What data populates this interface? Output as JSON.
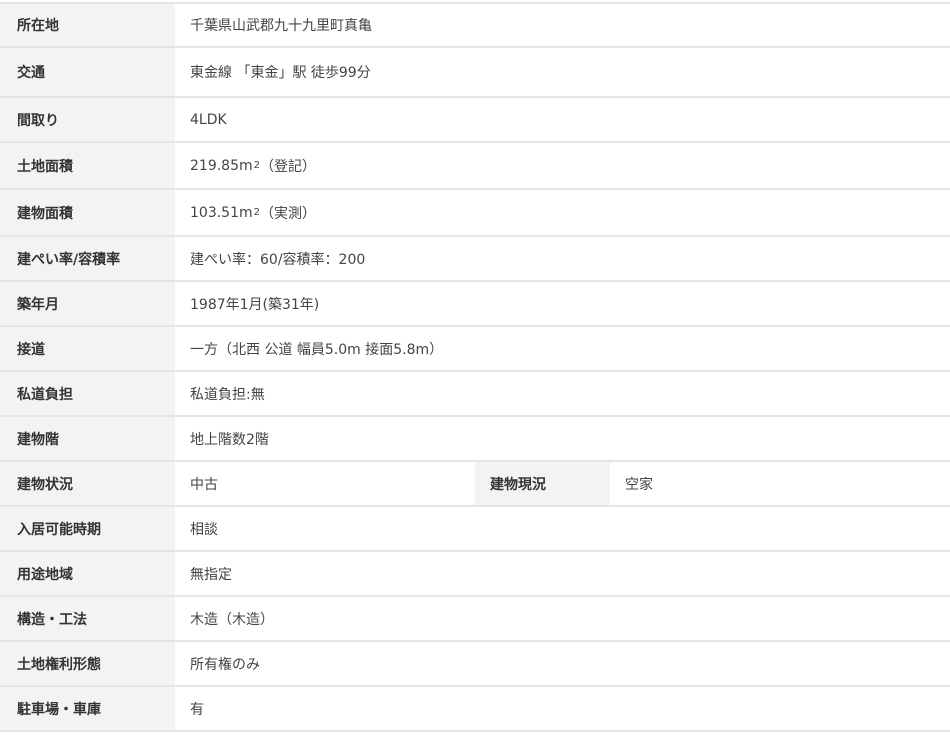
{
  "rows": [
    {
      "label": "所在地",
      "value": "千葉県山武郡九十九里町真亀"
    },
    {
      "label": "交通",
      "value": "東金線 「東金」駅 徒歩99分"
    },
    {
      "label": "間取り",
      "value": "4LDK"
    },
    {
      "label": "土地面積",
      "value_pre": "219.85m",
      "value_sup": "2",
      "value_post": "（登記）"
    },
    {
      "label": "建物面積",
      "value_pre": "103.51m",
      "value_sup": "2",
      "value_post": "（実測）"
    },
    {
      "label": "建ぺい率/容積率",
      "value": "建ぺい率：60/容積率：200"
    },
    {
      "label": "築年月",
      "value": "1987年1月(築31年)"
    },
    {
      "label": "接道",
      "value": "一方（北西 公道 幅員5.0m 接面5.8m）"
    },
    {
      "label": "私道負担",
      "value": "私道負担:無"
    },
    {
      "label": "建物階",
      "value": "地上階数2階"
    },
    {
      "label": "建物状況",
      "value": "中古",
      "label2": "建物現況",
      "value2": "空家"
    },
    {
      "label": "入居可能時期",
      "value": "相談"
    },
    {
      "label": "用途地域",
      "value": "無指定"
    },
    {
      "label": "構造・工法",
      "value": "木造（木造）"
    },
    {
      "label": "土地権利形態",
      "value": "所有権のみ"
    },
    {
      "label": "駐車場・車庫",
      "value": "有"
    }
  ]
}
